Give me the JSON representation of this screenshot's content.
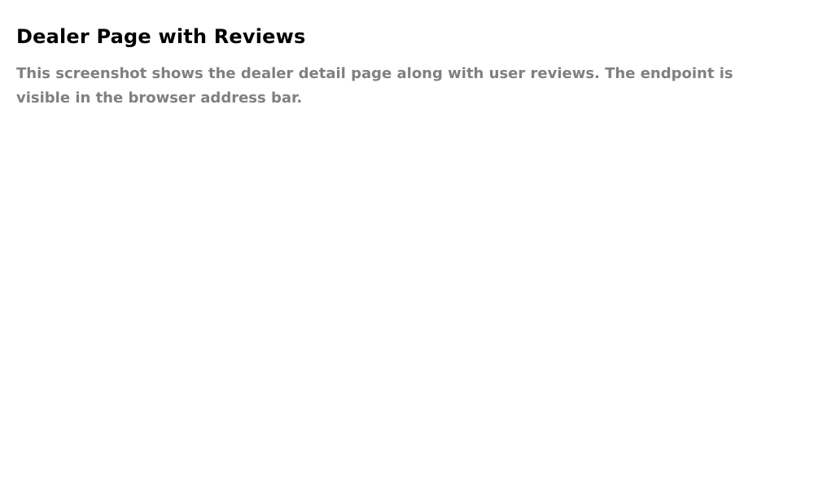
{
  "page": {
    "title": "Dealer Page with Reviews",
    "description": "This screenshot shows the dealer detail page along with user reviews. The endpoint is visible in the browser address bar."
  },
  "colors": {
    "background": "#ffffff",
    "title": "#000000",
    "description": "#808080"
  }
}
